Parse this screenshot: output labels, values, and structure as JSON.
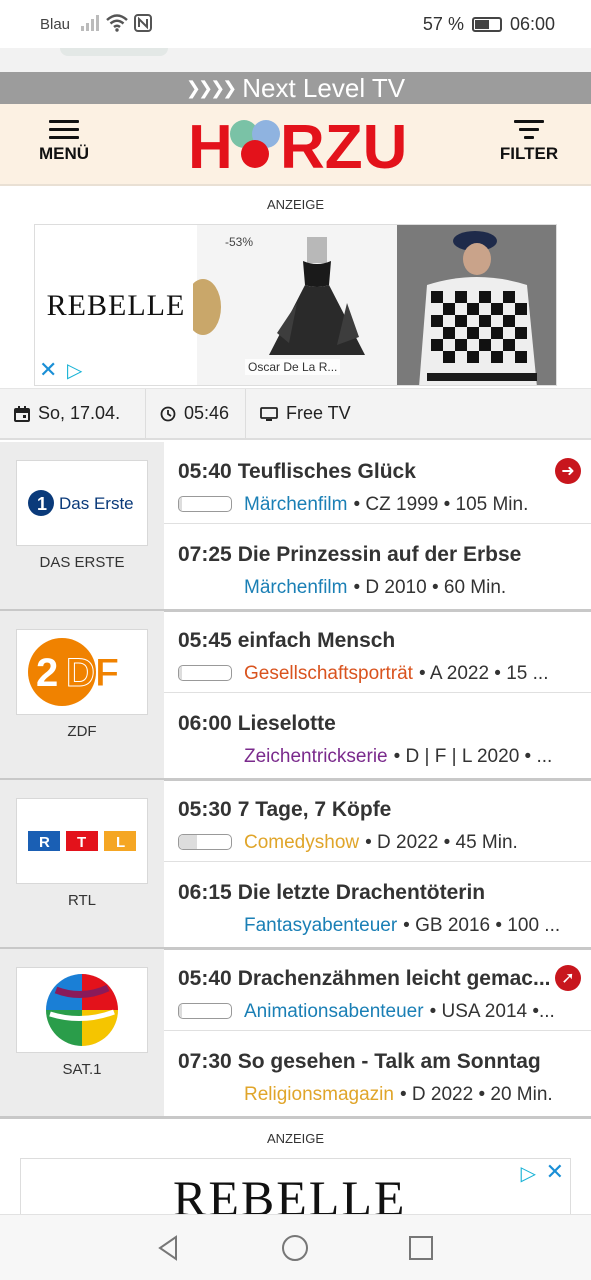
{
  "status": {
    "carrier": "Blau",
    "battery": "57 %",
    "time": "06:00"
  },
  "banner": {
    "text": "Next Level TV"
  },
  "header": {
    "menu_label": "MENÜ",
    "logo_text": "HÖRZU",
    "filter_label": "FILTER"
  },
  "ad_top": {
    "label": "ANZEIGE",
    "brand": "REBELLE",
    "discount": "-53%",
    "product_brand": "Oscar De La R..."
  },
  "datebar": {
    "date": "So, 17.04.",
    "time": "05:46",
    "package": "Free TV"
  },
  "channels": [
    {
      "name": "DAS ERSTE",
      "logo_text": "Das Erste",
      "programs": [
        {
          "time": "05:40",
          "title": "Teuflisches Glück",
          "genre": "Märchenfilm",
          "genre_color": "#1a7fb5",
          "details": "• CZ 1999 • 105 Min.",
          "progress": 0.05,
          "arrow": "right"
        },
        {
          "time": "07:25",
          "title": "Die Prinzessin auf der Erbse",
          "genre": "Märchenfilm",
          "genre_color": "#1a7fb5",
          "details": "• D 2010 • 60 Min."
        }
      ]
    },
    {
      "name": "ZDF",
      "logo_text": "2DF",
      "programs": [
        {
          "time": "05:45",
          "title": "einfach Mensch",
          "genre": "Gesellschaftsporträt",
          "genre_color": "#d9531e",
          "details": "• A 2022 • 15 ...",
          "progress": 0.05
        },
        {
          "time": "06:00",
          "title": "Lieselotte",
          "genre": "Zeichentrickserie",
          "genre_color": "#7a2a8c",
          "details": "• D | F | L 2020 • ..."
        }
      ]
    },
    {
      "name": "RTL",
      "logo_text": "RTL",
      "programs": [
        {
          "time": "05:30",
          "title": "7 Tage, 7 Köpfe",
          "genre": "Comedyshow",
          "genre_color": "#e0a52a",
          "details": "• D 2022 • 45 Min.",
          "progress": 0.35
        },
        {
          "time": "06:15",
          "title": "Die letzte Drachentöterin",
          "genre": "Fantasyabenteuer",
          "genre_color": "#1a7fb5",
          "details": "• GB 2016 • 100 ..."
        }
      ]
    },
    {
      "name": "SAT.1",
      "logo_text": "SAT.1",
      "programs": [
        {
          "time": "05:40",
          "title": "Drachenzähmen leicht gemac...",
          "genre": "Animationsabenteuer",
          "genre_color": "#1a7fb5",
          "details": "• USA 2014 •...",
          "progress": 0.05,
          "arrow": "up-right"
        },
        {
          "time": "07:30",
          "title": "So gesehen - Talk am Sonntag",
          "genre": "Religionsmagazin",
          "genre_color": "#e0a52a",
          "details": "• D 2022 • 20 Min."
        }
      ]
    }
  ],
  "ad_bottom": {
    "label": "ANZEIGE",
    "brand": "REBELLE"
  },
  "icons": [
    "signal-icon",
    "wifi-icon",
    "nfc-icon",
    "battery-icon",
    "menu-icon",
    "filter-icon",
    "calendar-icon",
    "clock-icon",
    "tv-icon",
    "close-icon",
    "adchoices-icon",
    "arrow-right-icon",
    "arrow-up-right-icon",
    "back-icon",
    "home-icon",
    "recents-icon"
  ]
}
